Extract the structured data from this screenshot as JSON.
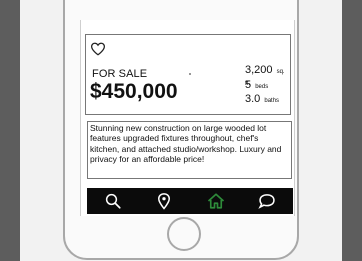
{
  "listing": {
    "status": "FOR SALE",
    "price": "$450,000",
    "sqft_value": "3,200",
    "sqft_unit": "sq. ft.",
    "beds_value": "5",
    "beds_unit": "beds",
    "baths_value": "3.0",
    "baths_unit": "baths",
    "description": "Stunning new construction on large wooded lot features upgraded fixtures throughout, chef's kitchen, and attached studio/workshop. Luxury and privacy for an affordable price!"
  },
  "tabbar": {
    "items": [
      {
        "icon": "search-icon"
      },
      {
        "icon": "map-pin-icon"
      },
      {
        "icon": "home-icon",
        "active_color": "#2e8b3a"
      },
      {
        "icon": "chat-bubble-icon"
      }
    ]
  },
  "colors": {
    "tabbar_bg": "#0b0b0b",
    "active_tab": "#2e8b3a",
    "inactive_tab": "#ffffff"
  }
}
